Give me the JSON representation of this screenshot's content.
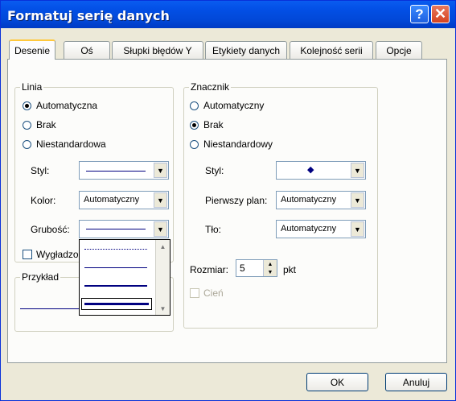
{
  "window": {
    "title": "Formatuj serię danych"
  },
  "tabs": [
    {
      "label": "Desenie",
      "active": true
    },
    {
      "label": "Oś"
    },
    {
      "label": "Słupki błędów Y"
    },
    {
      "label": "Etykiety danych"
    },
    {
      "label": "Kolejność serii"
    },
    {
      "label": "Opcje"
    }
  ],
  "linia": {
    "title": "Linia",
    "radios": [
      {
        "label": "Automatyczna",
        "selected": true
      },
      {
        "label": "Brak",
        "selected": false
      },
      {
        "label": "Niestandardowa",
        "selected": false
      }
    ],
    "styl_label": "Styl:",
    "kolor_label": "Kolor:",
    "kolor_value": "Automatyczny",
    "grubosc_label": "Grubość:",
    "wygladz_label": "Wygładzo",
    "przyklad_label": "Przykład"
  },
  "znacznik": {
    "title": "Znacznik",
    "radios": [
      {
        "label": "Automatyczny",
        "selected": false
      },
      {
        "label": "Brak",
        "selected": true
      },
      {
        "label": "Niestandardowy",
        "selected": false
      }
    ],
    "styl_label": "Styl:",
    "marker_glyph": "◆",
    "pierwszy_plan_label": "Pierwszy plan:",
    "pierwszy_plan_value": "Automatyczny",
    "tlo_label": "Tło:",
    "tlo_value": "Automatyczny",
    "rozmiar_label": "Rozmiar:",
    "rozmiar_value": "5",
    "rozmiar_unit": "pkt",
    "cien_label": "Cień"
  },
  "buttons": {
    "ok": "OK",
    "cancel": "Anuluj"
  },
  "icons": {
    "help": "help-icon",
    "close": "close-icon",
    "dropdown": "chevron-down-icon"
  },
  "colors": {
    "titlebar": "#0148d8",
    "line_sample": "#000080",
    "marker": "#000080"
  }
}
